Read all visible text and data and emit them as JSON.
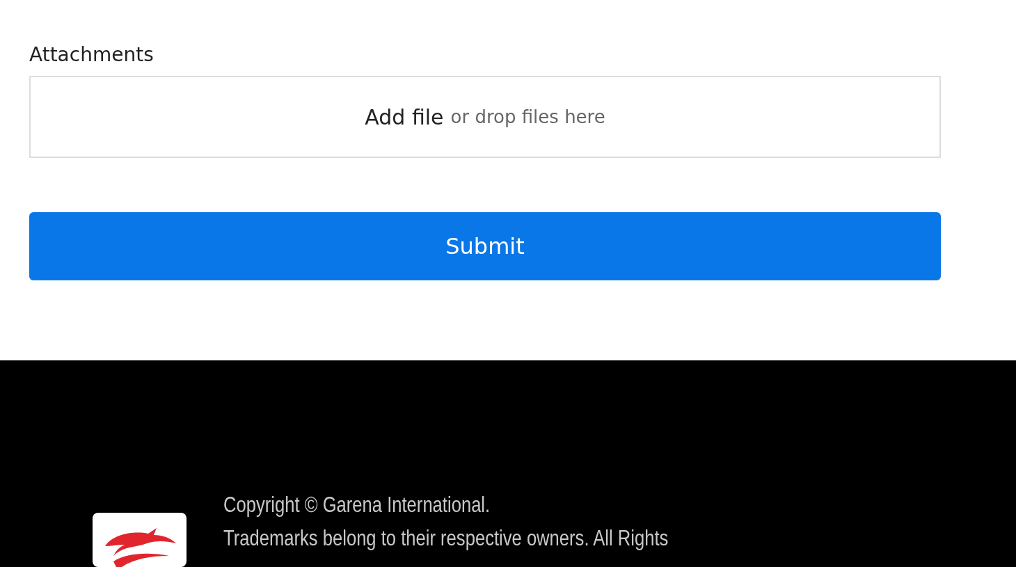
{
  "attachments": {
    "label": "Attachments",
    "add_file": "Add file",
    "hint": "or drop files here"
  },
  "submit": {
    "label": "Submit"
  },
  "footer": {
    "lines": [
      "Copyright © Garena International.",
      "Trademarks belong to their respective owners. All Rights"
    ]
  }
}
